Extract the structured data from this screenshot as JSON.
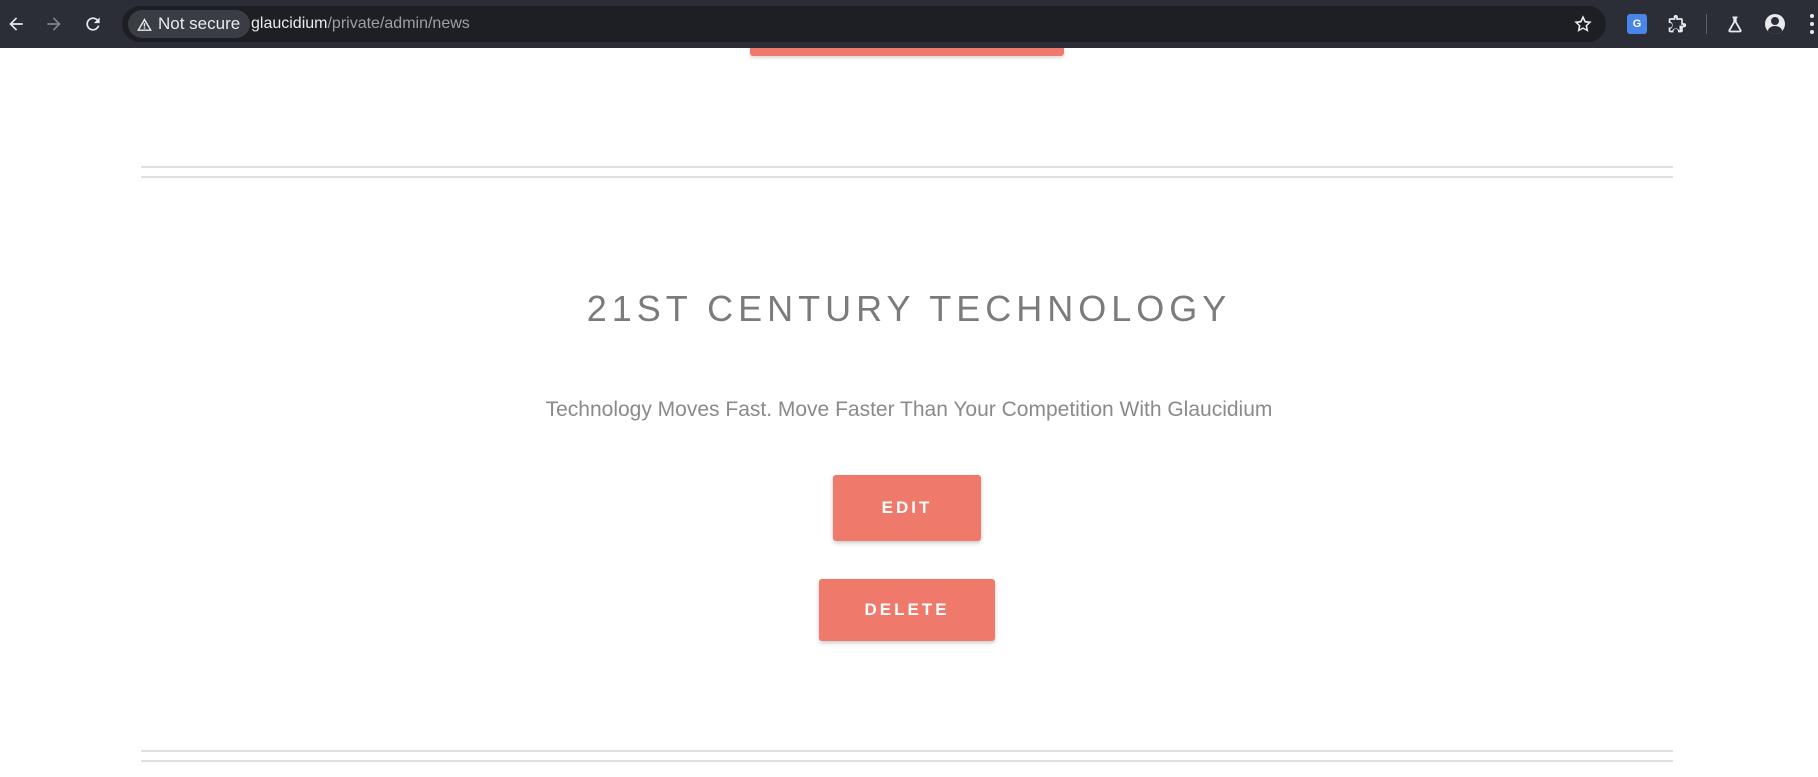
{
  "browser": {
    "security_label": "Not secure",
    "url_host": "glaucidium",
    "url_path": "/private/admin/news",
    "icons": {
      "back": "back-arrow-icon",
      "forward": "forward-arrow-icon",
      "reload": "reload-icon",
      "warning": "warning-icon",
      "bookmark": "star-icon",
      "translate": "translate-icon",
      "extensions": "puzzle-icon",
      "labs": "flask-icon",
      "profile": "profile-icon",
      "menu": "kebab-menu-icon"
    },
    "colors": {
      "toolbar": "#2b2e36",
      "omnibox": "#1d1f24"
    }
  },
  "news_item": {
    "title": "21ST CENTURY TECHNOLOGY",
    "subtitle": "Technology Moves Fast. Move Faster Than Your Competition With Glaucidium",
    "edit_label": "EDIT",
    "delete_label": "DELETE"
  },
  "theme": {
    "accent": "#ef7a6c",
    "title_color": "#7b7b7b",
    "divider_color": "#e0e0e0"
  }
}
